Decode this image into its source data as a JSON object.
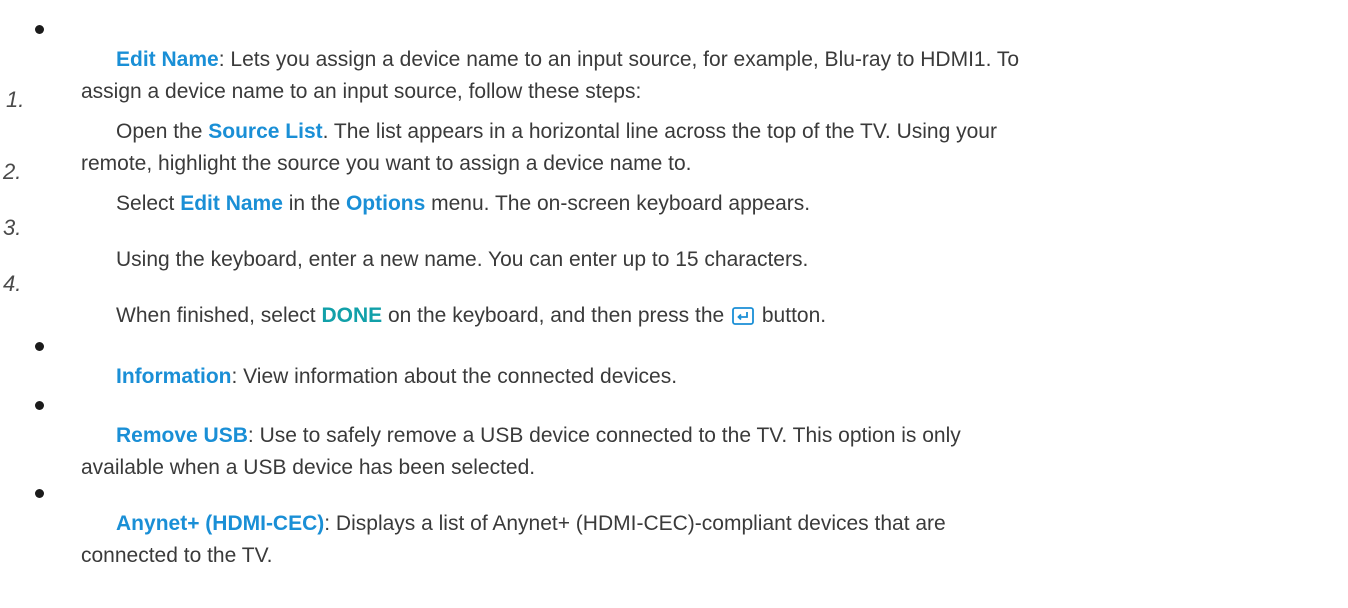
{
  "items": [
    {
      "marker": "bullet",
      "keyword": "Edit Name",
      "line1": ": Lets you assign a device name to an input source, for example, Blu-ray to HDMI1. To",
      "line2": "assign a device name to an input source, follow these steps:"
    },
    {
      "marker": "1.",
      "before": "Open the ",
      "keyword": "Source List",
      "line1": ". The list appears in a horizontal line across the top of the TV. Using your",
      "line2": "remote, highlight the source you want to assign a device name to."
    },
    {
      "marker": "2.",
      "before": "Select ",
      "keyword": "Edit Name",
      "middle": " in the ",
      "keyword2": "Options",
      "line1": " menu. The on-screen keyboard appears."
    },
    {
      "marker": "3.",
      "line1": "Using the keyboard, enter a new name. You can enter up to 15 characters."
    },
    {
      "marker": "4.",
      "before": "When finished, select ",
      "keyword": "DONE",
      "middle": " on the keyboard, and then press the ",
      "icon": "enter-button-icon",
      "line1": " button."
    },
    {
      "marker": "bullet",
      "keyword": "Information",
      "line1": ": View information about the connected devices."
    },
    {
      "marker": "bullet",
      "keyword": "Remove USB",
      "line1": ": Use to safely remove a USB device connected to the TV. This option is only",
      "line2": "available when a USB device has been selected."
    },
    {
      "marker": "bullet",
      "keyword": "Anynet+ (HDMI-CEC)",
      "line1": ": Displays a list of Anynet+ (HDMI-CEC)-compliant devices that are",
      "line2": "connected to the TV."
    }
  ],
  "colors": {
    "keyword": "#1a8fd6",
    "done": "#11a0a9",
    "text": "#3a3a3a"
  }
}
